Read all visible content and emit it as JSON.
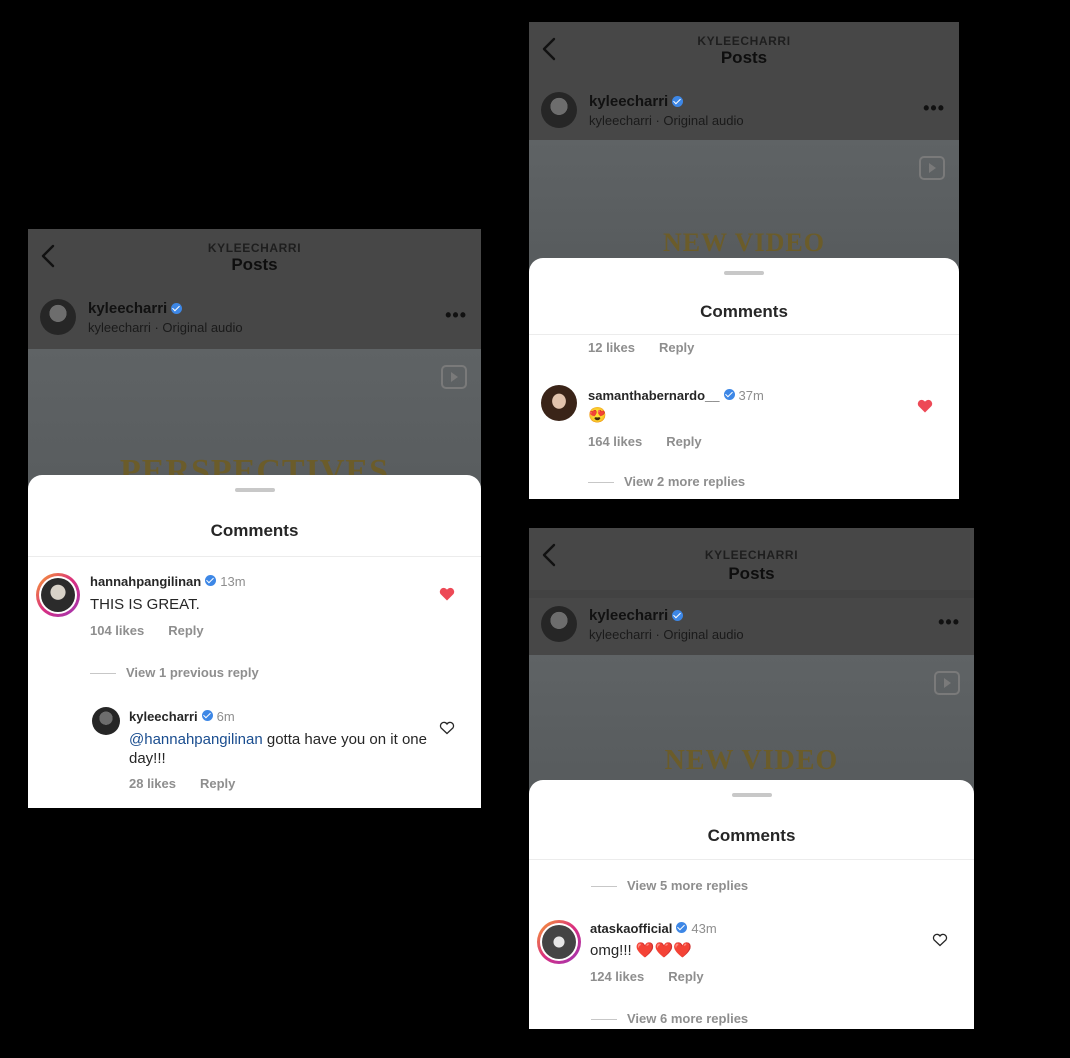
{
  "panel1": {
    "header": {
      "username": "KYLEECHARRI",
      "title": "Posts"
    },
    "post": {
      "name": "kyleecharri",
      "sub": "kyleecharri · Original audio",
      "more": "•••"
    },
    "video_title": "PERSPECTIVES",
    "sheet_title": "Comments",
    "comment": {
      "user": "hannahpangilinan",
      "time": "13m",
      "text": "THIS IS GREAT.",
      "likes": "104 likes",
      "reply": "Reply"
    },
    "view_previous": "View 1 previous reply",
    "reply": {
      "user": "kyleecharri",
      "time": "6m",
      "mention": "@hannahpangilinan",
      "text": " gotta have you on it one day!!!",
      "likes": "28 likes",
      "reply": "Reply"
    }
  },
  "panel2": {
    "header": {
      "username": "KYLEECHARRI",
      "title": "Posts"
    },
    "post": {
      "name": "kyleecharri",
      "sub": "kyleecharri · Original audio",
      "more": "•••"
    },
    "video_title": "NEW VIDEO",
    "sheet_title": "Comments",
    "top_row": {
      "likes": "12 likes",
      "reply": "Reply"
    },
    "comment": {
      "user": "samanthabernardo__",
      "time": "37m",
      "text": "😍",
      "likes": "164 likes",
      "reply": "Reply"
    },
    "view_more": "View 2 more replies"
  },
  "panel3": {
    "header": {
      "username": "KYLEECHARRI",
      "title": "Posts"
    },
    "post": {
      "name": "kyleecharri",
      "sub": "kyleecharri · Original audio",
      "more": "•••"
    },
    "video_title": "NEW VIDEO",
    "sheet_title": "Comments",
    "view_more_top": "View 5 more replies",
    "comment": {
      "user": "ataskaofficial",
      "time": "43m",
      "text": "omg!!! ❤️❤️❤️",
      "likes": "124 likes",
      "reply": "Reply"
    },
    "view_more_bottom": "View 6 more replies"
  },
  "colors": {
    "verified": "#3d87e6",
    "like_red": "#ed4956",
    "mention": "#1a4d8f",
    "background": "#000000"
  }
}
